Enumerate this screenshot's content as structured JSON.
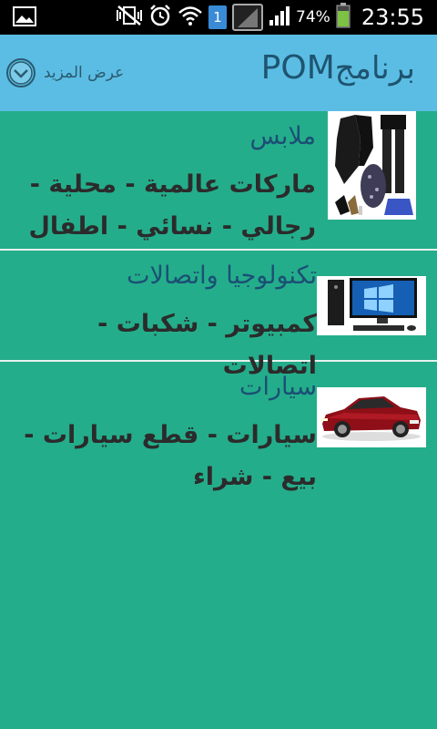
{
  "status_bar": {
    "icons_left": [
      "image-icon"
    ],
    "icons_right": [
      "mute-vibrate-icon",
      "alarm-icon",
      "wifi-icon",
      "sim-icon",
      "signal-icon",
      "battery-icon"
    ],
    "sim_number": "1",
    "battery_percent": "74%",
    "time": "23:55"
  },
  "action_bar": {
    "title_prefix": "برنامج",
    "title_app": "POM",
    "more_label": "عرض المزيد",
    "more_icon": "chevron-down-circle-icon",
    "background": "#5bbde4"
  },
  "list": {
    "items": [
      {
        "title": "ملابس",
        "description": "ماركات عالمية - محلية - رجالي - نسائي - اطفال",
        "thumbnail": "clothing-image"
      },
      {
        "title": "تكنولوجيا واتصالات",
        "description": "كمبيوتر - شكبات - اتصالات",
        "thumbnail": "computer-image"
      },
      {
        "title": "سيارات",
        "description": "سيارات - قطع سيارات - بيع - شراء",
        "thumbnail": "car-image"
      }
    ]
  },
  "colors": {
    "background": "#24ad8b",
    "title_text": "#1b4f74",
    "action_bar": "#5bbde4"
  }
}
